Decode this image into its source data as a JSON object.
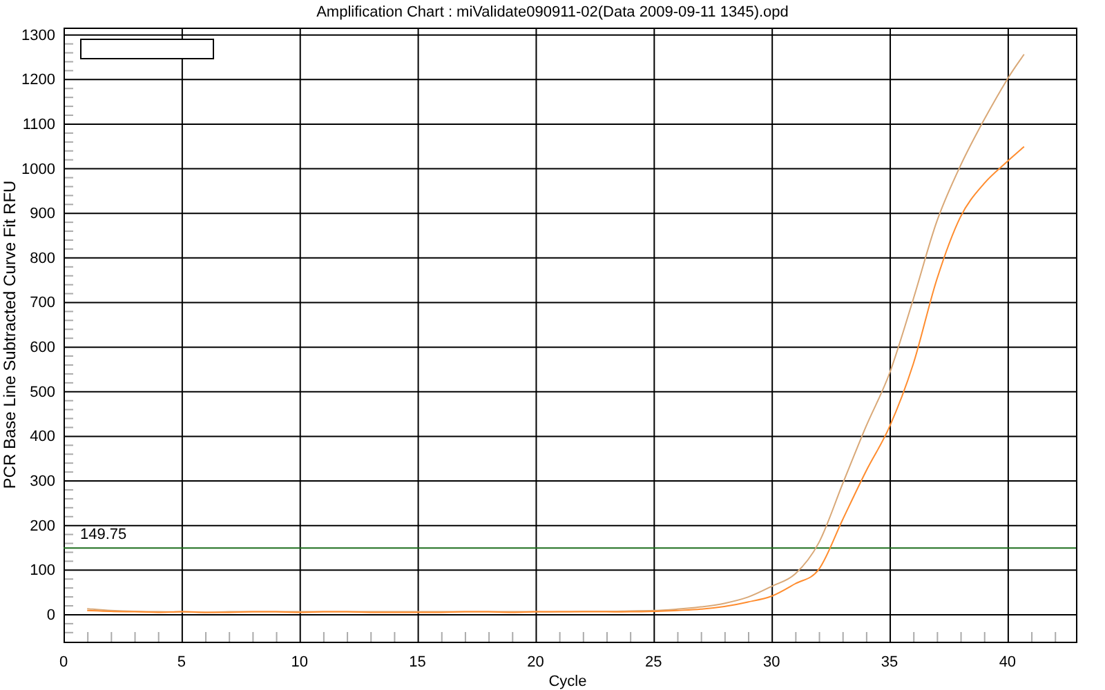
{
  "chart": {
    "chart_data": {
      "type": "line",
      "title": "Amplification Chart : miValidate090911-02(Data 2009-09-11 1345).opd",
      "xlabel": "Cycle",
      "ylabel": "PCR Base Line Subtracted Curve Fit RFU",
      "x": [
        1,
        2,
        3,
        4,
        5,
        6,
        7,
        8,
        9,
        10,
        11,
        12,
        13,
        14,
        15,
        16,
        17,
        18,
        19,
        20,
        21,
        22,
        23,
        24,
        25,
        26,
        27,
        28,
        29,
        30,
        31,
        32,
        33,
        34,
        35,
        36,
        37,
        38,
        39,
        40,
        40.7
      ],
      "series": [
        {
          "color": "#d9a877",
          "values": [
            12,
            8,
            6,
            5,
            5,
            4,
            5,
            5,
            5,
            5,
            5,
            5,
            5,
            5,
            5,
            5,
            5,
            5,
            5,
            5,
            5,
            6,
            6,
            7,
            8,
            11,
            16,
            24,
            38,
            62,
            90,
            160,
            290,
            420,
            540,
            705,
            880,
            1005,
            1108,
            1200,
            1255
          ]
        },
        {
          "color": "#ff8c2e",
          "values": [
            8,
            6,
            5,
            4,
            5,
            4,
            4,
            5,
            5,
            4,
            5,
            5,
            4,
            4,
            4,
            4,
            5,
            5,
            4,
            5,
            5,
            5,
            5,
            5,
            6,
            8,
            11,
            17,
            27,
            40,
            68,
            100,
            210,
            320,
            420,
            560,
            750,
            890,
            965,
            1015,
            1048
          ]
        }
      ],
      "xlim": [
        0,
        42.9
      ],
      "ylim": [
        -62,
        1315
      ],
      "xticks": [
        0,
        5,
        10,
        15,
        20,
        25,
        30,
        35,
        40
      ],
      "yticks": [
        0,
        100,
        200,
        300,
        400,
        500,
        600,
        700,
        800,
        900,
        1000,
        1100,
        1200,
        1300
      ],
      "grid": true,
      "ref_lines": [
        {
          "axis": "y",
          "value": 149.75,
          "label": "149.75",
          "color": "#1e6e1e"
        }
      ]
    }
  }
}
